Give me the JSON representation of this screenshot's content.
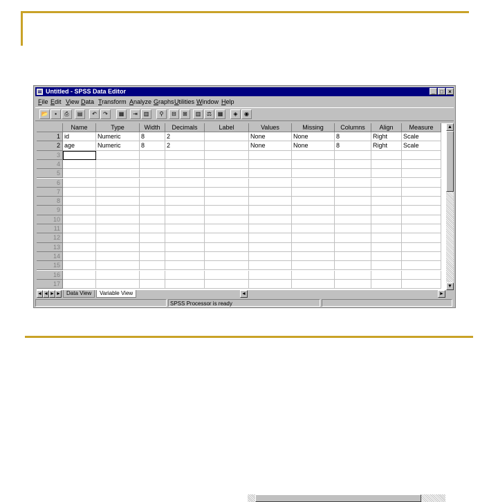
{
  "window": {
    "title": "Untitled - SPSS Data Editor",
    "min_glyph": "_",
    "max_glyph": "□",
    "close_glyph": "×"
  },
  "menu": [
    "File",
    "Edit",
    "View",
    "Data",
    "Transform",
    "Analyze",
    "Graphs",
    "Utilities",
    "Window",
    "Help"
  ],
  "toolbar_icons": [
    "open-icon",
    "save-icon",
    "print-icon",
    "dialog-recall-icon",
    "undo-icon",
    "redo-icon",
    "goto-chart-icon",
    "goto-case-icon",
    "variables-icon",
    "find-icon",
    "insert-case-icon",
    "insert-variable-icon",
    "split-file-icon",
    "weight-cases-icon",
    "select-cases-icon",
    "value-labels-icon",
    "use-sets-icon"
  ],
  "grid": {
    "columns": [
      "Name",
      "Type",
      "Width",
      "Decimals",
      "Label",
      "Values",
      "Missing",
      "Columns",
      "Align",
      "Measure"
    ],
    "row_numbers": [
      "1",
      "2",
      "3",
      "4",
      "5",
      "6",
      "7",
      "8",
      "9",
      "10",
      "11",
      "12",
      "13",
      "14",
      "15",
      "16",
      "17"
    ],
    "rows": [
      [
        "id",
        "Numeric",
        "8",
        "2",
        "",
        "None",
        "None",
        "8",
        "Right",
        "Scale"
      ],
      [
        "age",
        "Numeric",
        "8",
        "2",
        "",
        "None",
        "None",
        "8",
        "Right",
        "Scale"
      ]
    ]
  },
  "tabs": [
    "Data View",
    "Variable View"
  ],
  "active_tab": "Variable View",
  "status": "SPSS Processor is ready",
  "colors": {
    "slide_accent": "#c9a227",
    "titlebar": "#000080",
    "chrome": "#c0c0c0"
  }
}
